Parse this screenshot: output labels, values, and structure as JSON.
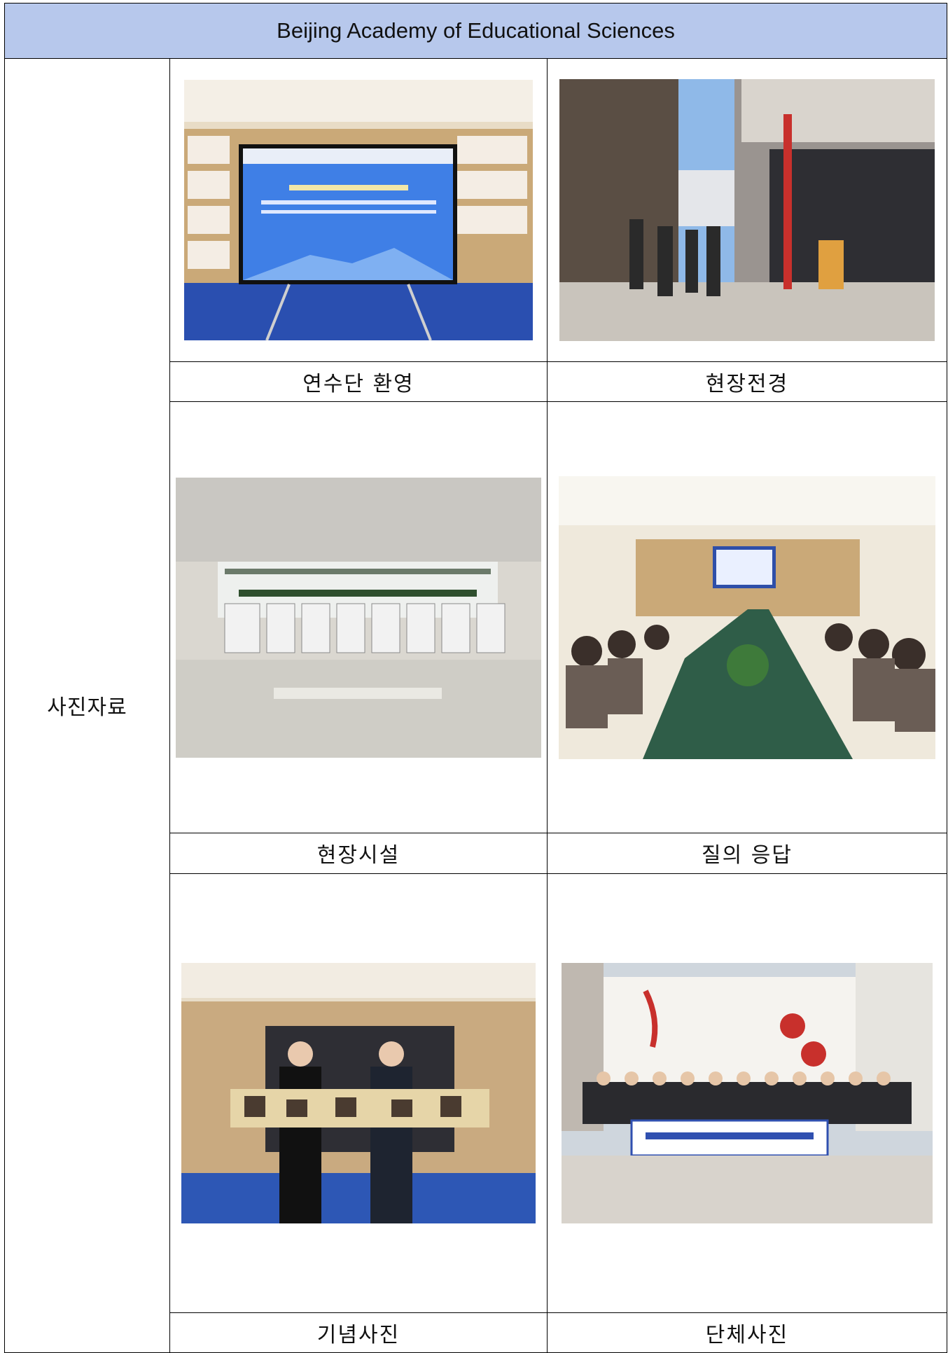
{
  "header": {
    "title": "Beijing Academy of Educational Sciences"
  },
  "side_label": "사진자료",
  "photos": [
    {
      "caption": "연수단 환영",
      "icon": "welcome-screen-photo"
    },
    {
      "caption": "현장전경",
      "icon": "campus-entrance-photo"
    },
    {
      "caption": "현장시설",
      "icon": "exhibition-hall-photo"
    },
    {
      "caption": "질의 응답",
      "icon": "meeting-room-photo"
    },
    {
      "caption": "기념사진",
      "icon": "commemorative-photo"
    },
    {
      "caption": "단체사진",
      "icon": "group-photo"
    }
  ],
  "colors": {
    "header_bg": "#b7c8ec",
    "border": "#000000"
  }
}
